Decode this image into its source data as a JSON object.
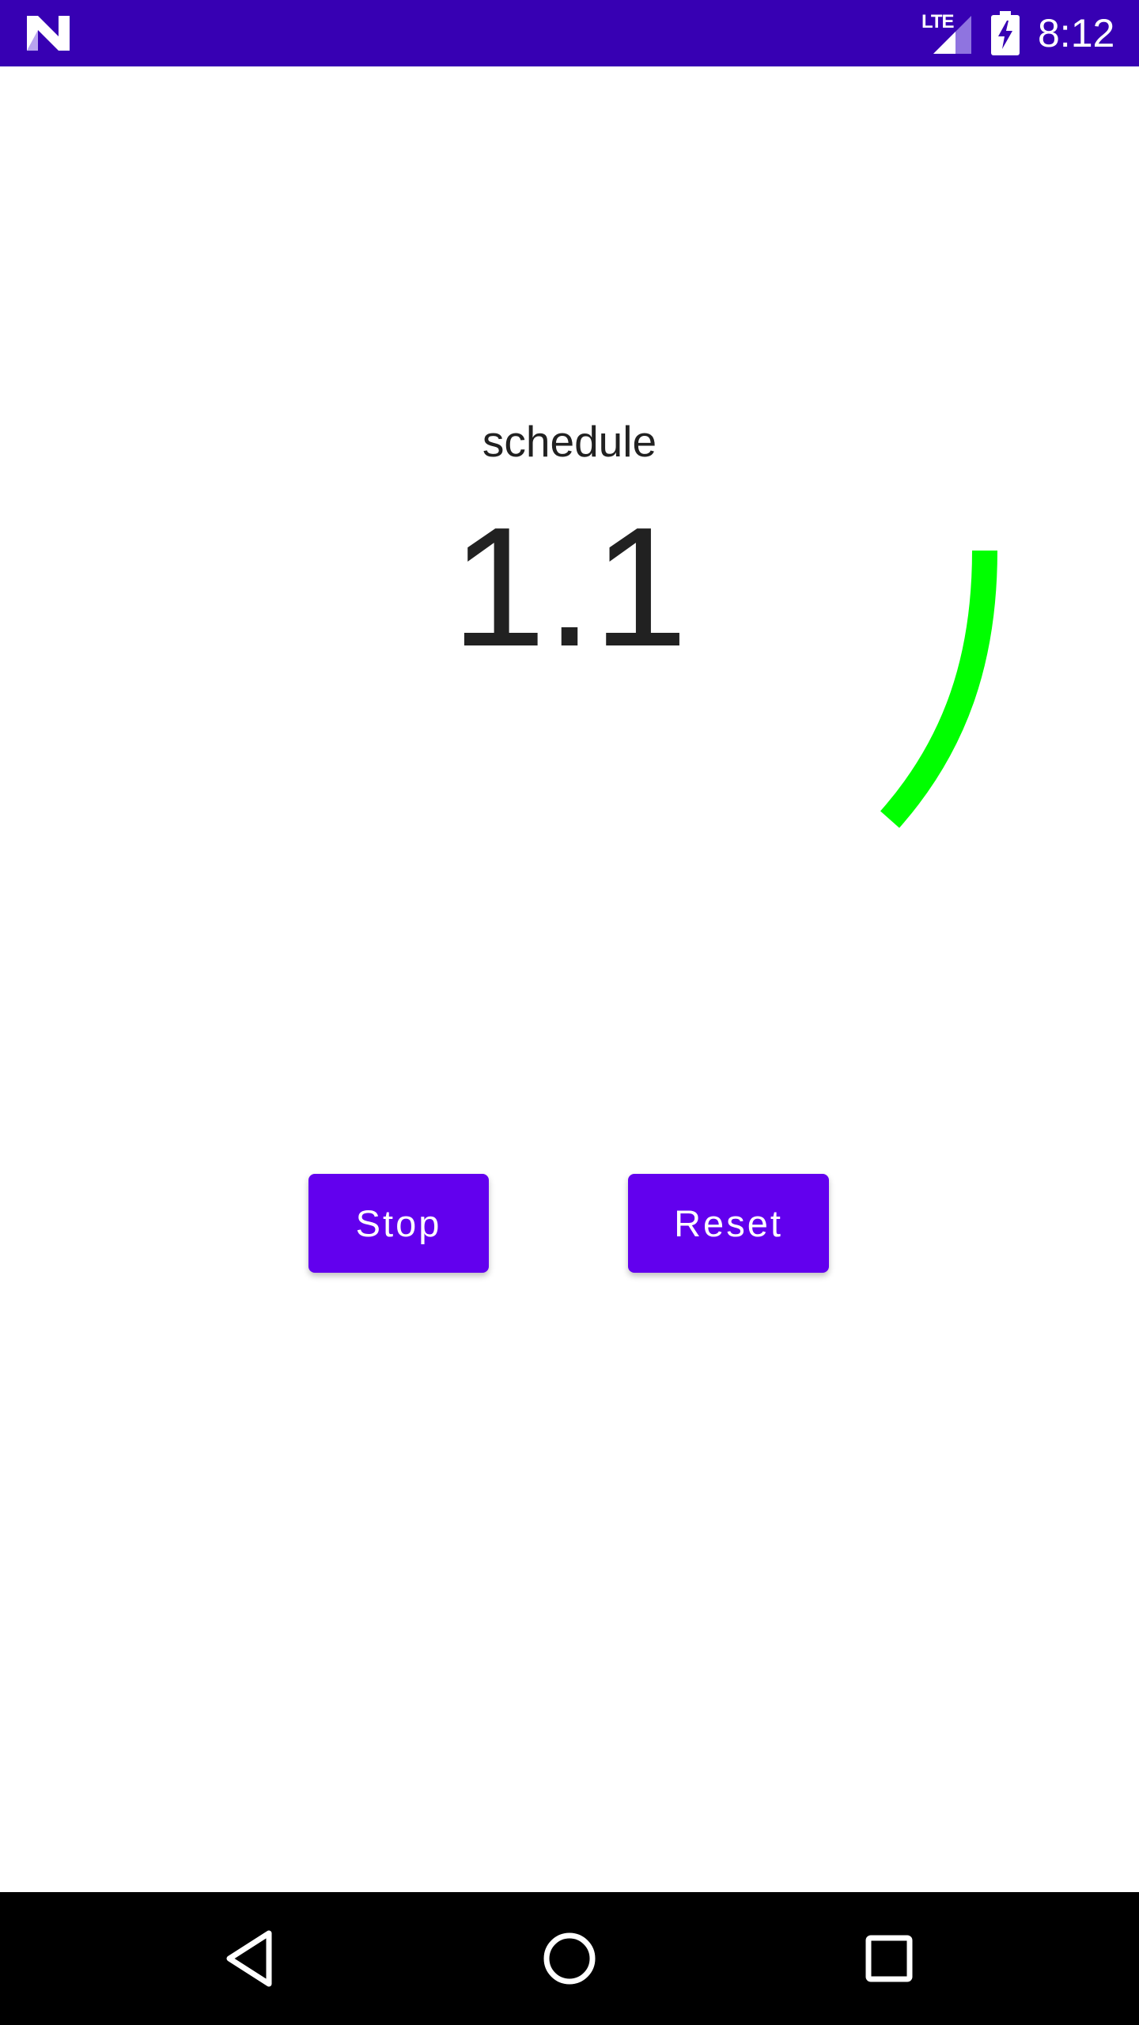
{
  "status_bar": {
    "network_type": "LTE",
    "time": "8:12",
    "icons": [
      "app-logo-icon",
      "signal-icon",
      "battery-charging-icon"
    ]
  },
  "main": {
    "title": "schedule",
    "value": "1.1",
    "progress_arc_color": "#00FF00"
  },
  "buttons": {
    "stop_label": "Stop",
    "reset_label": "Reset"
  },
  "nav_bar": {
    "icons": [
      "back-icon",
      "home-icon",
      "recents-icon"
    ]
  },
  "colors": {
    "status_bar": "#3700B3",
    "button": "#6200EE",
    "text": "#212121",
    "nav_bar": "#000000"
  }
}
